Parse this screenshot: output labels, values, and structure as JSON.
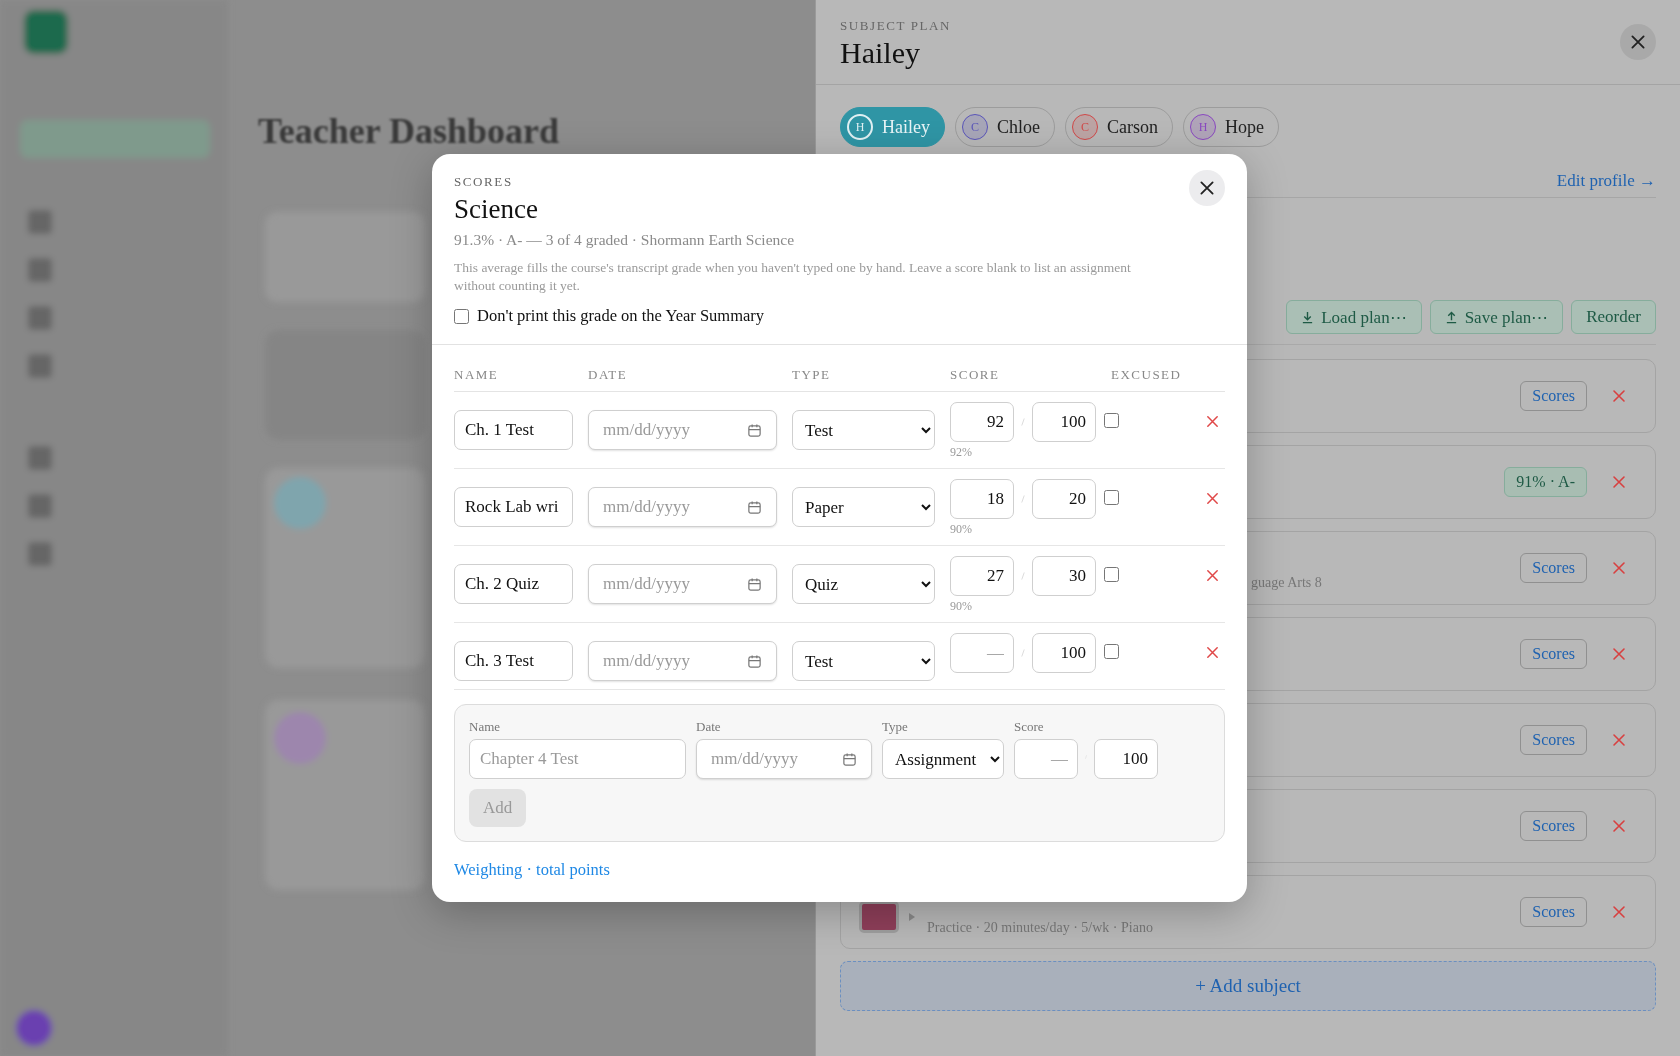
{
  "background_page": {
    "title": "Teacher Dashboard"
  },
  "drawer": {
    "eyebrow": "SUBJECT PLAN",
    "title": "Hailey",
    "students": [
      {
        "initial": "H",
        "name": "Hailey",
        "selected": true,
        "color": "#2f95a5"
      },
      {
        "initial": "C",
        "name": "Chloe",
        "selected": false,
        "color": "#5a55b8"
      },
      {
        "initial": "C",
        "name": "Carson",
        "selected": false,
        "color": "#d04848"
      },
      {
        "initial": "H",
        "name": "Hope",
        "selected": false,
        "color": "#8a48c0"
      }
    ],
    "edit_link": "Edit profile →",
    "actions": [
      {
        "kind": "download",
        "label": "Load plan⋯"
      },
      {
        "kind": "upload",
        "label": "Save plan⋯"
      },
      {
        "kind": "plain",
        "label": "Reorder"
      }
    ],
    "subjects": [
      {
        "badge": {
          "kind": "button",
          "label": "Scores"
        }
      },
      {
        "badge": {
          "kind": "grade",
          "label": "91% · A-"
        }
      },
      {
        "subtitle": "guage Arts 8",
        "badge": {
          "kind": "button",
          "label": "Scores"
        }
      },
      {
        "badge": {
          "kind": "button",
          "label": "Scores"
        }
      },
      {
        "badge": {
          "kind": "button",
          "label": "Scores"
        }
      },
      {
        "badge": {
          "kind": "button",
          "label": "Scores"
        }
      },
      {
        "color": "#8f3f5a",
        "subtitle": "Practice · 20 minutes/day · 5/wk · Piano",
        "badge": {
          "kind": "button",
          "label": "Scores"
        }
      }
    ],
    "add_button": "+ Add subject"
  },
  "modal": {
    "eyebrow": "SCORES",
    "title": "Science",
    "summary": "91.3% · A- — 3 of 4 graded · Shormann Earth Science",
    "note": "This average fills the course's transcript grade when you haven't typed one by hand. Leave a score blank to list an assignment without counting it yet.",
    "hide_option": {
      "label": "Don't print this grade on the Year Summary",
      "checked": false
    },
    "columns": [
      "NAME",
      "DATE",
      "TYPE",
      "SCORE",
      "EXCUSED"
    ],
    "rows": [
      {
        "name": "Ch. 1 Test",
        "date_placeholder": "mm/dd/yyyy",
        "type": "Test",
        "score": "92",
        "out_of": "100",
        "percent": "92%",
        "excused": false
      },
      {
        "name": "Rock Lab wri",
        "date_placeholder": "mm/dd/yyyy",
        "type": "Paper",
        "score": "18",
        "out_of": "20",
        "percent": "90%",
        "excused": false
      },
      {
        "name": "Ch. 2 Quiz",
        "date_placeholder": "mm/dd/yyyy",
        "type": "Quiz",
        "score": "27",
        "out_of": "30",
        "percent": "90%",
        "excused": false
      },
      {
        "name": "Ch. 3 Test",
        "date_placeholder": "mm/dd/yyyy",
        "type": "Test",
        "score_placeholder": "—",
        "out_of": "100",
        "excused": false
      }
    ],
    "new_item": {
      "labels": [
        "Name",
        "Date",
        "Type",
        "Score"
      ],
      "name_placeholder": "Chapter 4 Test",
      "date_placeholder": "mm/dd/yyyy",
      "type": "Assignment",
      "score_placeholder": "—",
      "out_of": "100",
      "add_button": {
        "label": "Add",
        "disabled": true
      }
    },
    "link": "Weighting · total points"
  }
}
